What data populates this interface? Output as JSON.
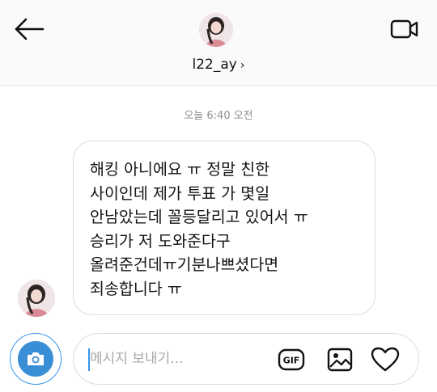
{
  "header": {
    "username": "l22_ay",
    "chevron": "›",
    "back_icon": "arrow-left-icon",
    "video_icon": "video-camera-icon"
  },
  "thread": {
    "timestamp": "오늘 6:40 오전",
    "message_lines": [
      "해킹 아니에요 ㅠ 정말 친한",
      "사이인데 제가 투표 가 몇일",
      "안남았는데 꼴등달리고 있어서 ㅠ",
      "승리가 저 도와준다구",
      "올려준건데ㅠ기분나쁘셨다면",
      "죄송합니다 ㅠ"
    ]
  },
  "composer": {
    "placeholder": "메시지 보내기...",
    "value": "",
    "camera_icon": "camera-icon",
    "gif_label": "GIF",
    "gallery_icon": "image-gallery-icon",
    "heart_icon": "heart-icon"
  },
  "colors": {
    "accent": "#3897f0",
    "camera": "#3a8ed6",
    "bubble_border": "#dcdcdc",
    "muted_text": "#8e8e8e"
  }
}
